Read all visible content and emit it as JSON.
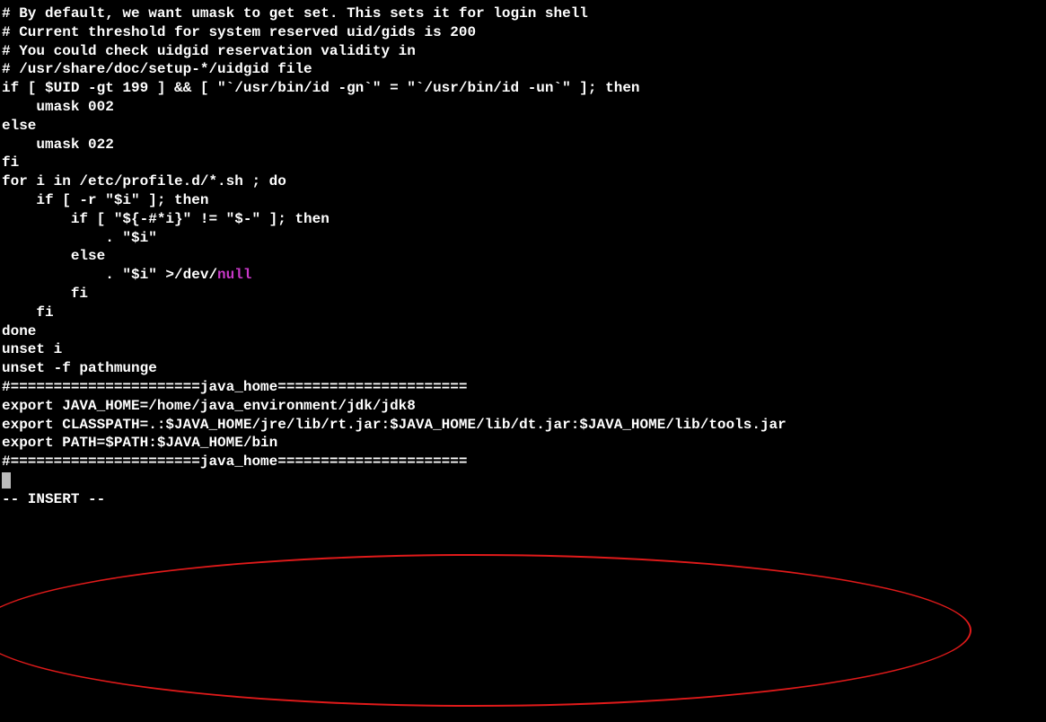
{
  "lines": {
    "l1": "# By default, we want umask to get set. This sets it for login shell",
    "l2": "# Current threshold for system reserved uid/gids is 200",
    "l3": "# You could check uidgid reservation validity in",
    "l4": "# /usr/share/doc/setup-*/uidgid file",
    "l5": "if [ $UID -gt 199 ] && [ \"`/usr/bin/id -gn`\" = \"`/usr/bin/id -un`\" ]; then",
    "l6": "    umask 002",
    "l7": "else",
    "l8": "    umask 022",
    "l9": "fi",
    "l10": "",
    "l11": "for i in /etc/profile.d/*.sh ; do",
    "l12": "    if [ -r \"$i\" ]; then",
    "l13": "        if [ \"${-#*i}\" != \"$-\" ]; then",
    "l14": "            . \"$i\"",
    "l15": "        else",
    "l16a": "            . \"$i\" >/dev/",
    "l16b": "null",
    "l17": "        fi",
    "l18": "    fi",
    "l19": "done",
    "l20": "",
    "l21": "unset i",
    "l22": "unset -f pathmunge",
    "l23": "",
    "l24": "",
    "l25": "#======================java_home======================",
    "l26": "export JAVA_HOME=/home/java_environment/jdk/jdk8",
    "l27": "export CLASSPATH=.:$JAVA_HOME/jre/lib/rt.jar:$JAVA_HOME/lib/dt.jar:$JAVA_HOME/lib/tools.jar",
    "l28": "export PATH=$PATH:$JAVA_HOME/bin",
    "l29": "#======================java_home======================",
    "l30": "",
    "l31": ""
  },
  "status": "-- INSERT --"
}
